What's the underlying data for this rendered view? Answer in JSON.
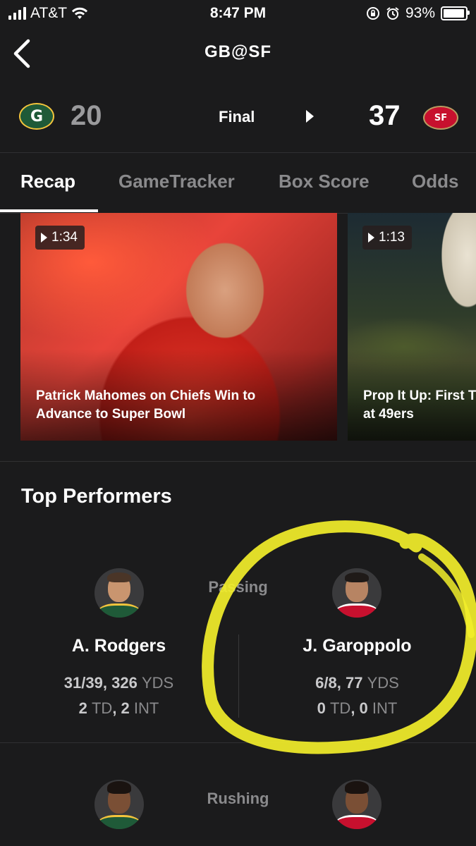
{
  "status_bar": {
    "carrier": "AT&T",
    "time": "8:47 PM",
    "battery": "93%"
  },
  "nav": {
    "title": "GB@SF"
  },
  "game": {
    "away": {
      "abbr": "GB",
      "logo_letter": "G",
      "score": "20"
    },
    "status": "Final",
    "home": {
      "abbr": "SF",
      "logo_text": "SF",
      "score": "37"
    }
  },
  "tabs": [
    "Recap",
    "GameTracker",
    "Box Score",
    "Odds"
  ],
  "videos": [
    {
      "duration": "1:34",
      "title_line1": "Patrick Mahomes on Chiefs Win to",
      "title_line2": "Advance to Super Bowl"
    },
    {
      "duration": "1:13",
      "title_line1": "Prop It Up: First T",
      "title_line2": "at 49ers"
    }
  ],
  "top_performers": {
    "title": "Top Performers",
    "passing": {
      "label": "Passing",
      "away": {
        "name": "A. Rodgers",
        "cmp": "31/39",
        "yds": "326",
        "yds_unit": "YDS",
        "td": "2",
        "td_unit": "TD",
        "int": "2",
        "int_unit": "INT"
      },
      "home": {
        "name": "J. Garoppolo",
        "cmp": "6/8",
        "yds": "77",
        "yds_unit": "YDS",
        "td": "0",
        "td_unit": "TD",
        "int": "0",
        "int_unit": "INT"
      }
    },
    "rushing": {
      "label": "Rushing"
    }
  },
  "colors": {
    "background": "#1b1b1c",
    "gb_green": "#1f5a38",
    "sf_red": "#c7102e",
    "highlight": "#f2ee2a"
  }
}
